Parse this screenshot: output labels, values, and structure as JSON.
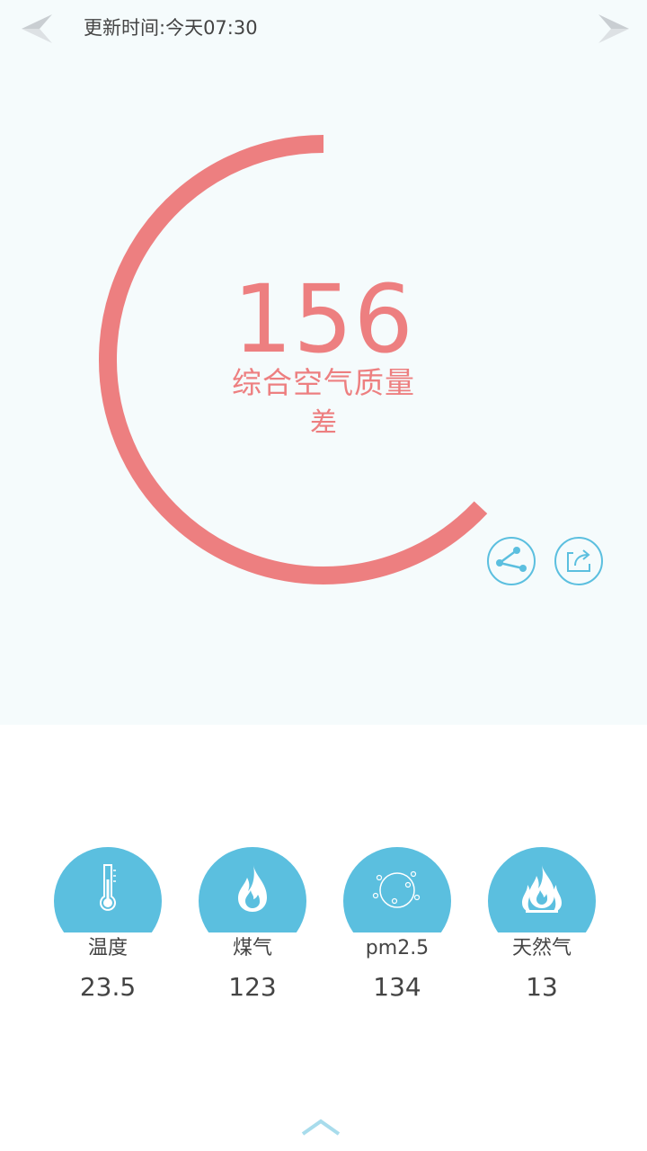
{
  "header": {
    "update_time": "更新时间:今天07:30",
    "left_icon": "paper-plane-left-icon",
    "right_icon": "paper-plane-right-icon"
  },
  "air_quality": {
    "value": "156",
    "label": "综合空气质量",
    "level": "差",
    "gauge_fraction": 0.63,
    "color": "#ed7f80"
  },
  "actions": {
    "share_icon": "share-icon",
    "export_icon": "export-icon",
    "color": "#5bbfdf"
  },
  "sensors": [
    {
      "label": "温度",
      "value": "23.5",
      "icon": "thermometer-icon"
    },
    {
      "label": "煤气",
      "value": "123",
      "icon": "flame-icon"
    },
    {
      "label": "pm2.5",
      "value": "134",
      "icon": "particles-icon"
    },
    {
      "label": "天然气",
      "value": "13",
      "icon": "double-flame-icon"
    }
  ],
  "footer": {
    "icon": "chevron-up-icon"
  }
}
